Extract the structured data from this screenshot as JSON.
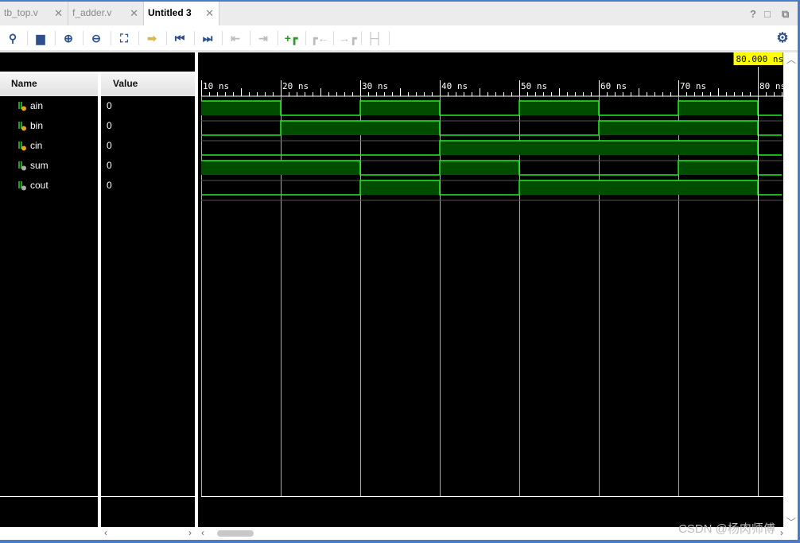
{
  "tabs": [
    {
      "label": "tb_top.v",
      "active": false
    },
    {
      "label": "f_adder.v",
      "active": false
    },
    {
      "label": "Untitled 3",
      "active": true
    }
  ],
  "window_buttons": {
    "help": "?",
    "maximize": "□"
  },
  "toolbar": [
    "search-icon",
    "save-icon",
    "zoom-in-icon",
    "zoom-out-icon",
    "zoom-fit-icon",
    "go-to-cursor-icon",
    "go-to-start-icon",
    "go-to-end-icon",
    "previous-transition-icon",
    "next-transition-icon",
    "add-marker-icon",
    "previous-marker-icon",
    "next-marker-icon",
    "swap-cursors-icon",
    "settings-icon"
  ],
  "columns": {
    "name": "Name",
    "value": "Value"
  },
  "signals": [
    {
      "name": "ain",
      "value": "0",
      "kind": "input"
    },
    {
      "name": "bin",
      "value": "0",
      "kind": "input"
    },
    {
      "name": "cin",
      "value": "0",
      "kind": "input"
    },
    {
      "name": "sum",
      "value": "0",
      "kind": "output"
    },
    {
      "name": "cout",
      "value": "0",
      "kind": "output"
    }
  ],
  "timeline": {
    "ticks": [
      "10 ns",
      "20 ns",
      "30 ns",
      "40 ns",
      "50 ns",
      "60 ns",
      "70 ns",
      "80 ns"
    ],
    "cursor": "80.000 ns",
    "cursor_ns": 80
  },
  "waveforms": {
    "times_ns": [
      10,
      20,
      30,
      40,
      50,
      60,
      70,
      80
    ],
    "ain": [
      1,
      0,
      1,
      0,
      1,
      0,
      1,
      0
    ],
    "bin": [
      0,
      1,
      1,
      0,
      0,
      1,
      1,
      0
    ],
    "cin": [
      0,
      0,
      0,
      1,
      1,
      1,
      1,
      0
    ],
    "sum": [
      1,
      1,
      0,
      1,
      0,
      0,
      1,
      0
    ],
    "cout": [
      0,
      0,
      1,
      0,
      1,
      1,
      1,
      0
    ]
  },
  "colors": {
    "wave": "#22ee22",
    "fill": "#004d00",
    "cursor": "#ffff00",
    "accent": "#4a7bc8"
  },
  "watermark": "CSDN @杨肉师傅"
}
